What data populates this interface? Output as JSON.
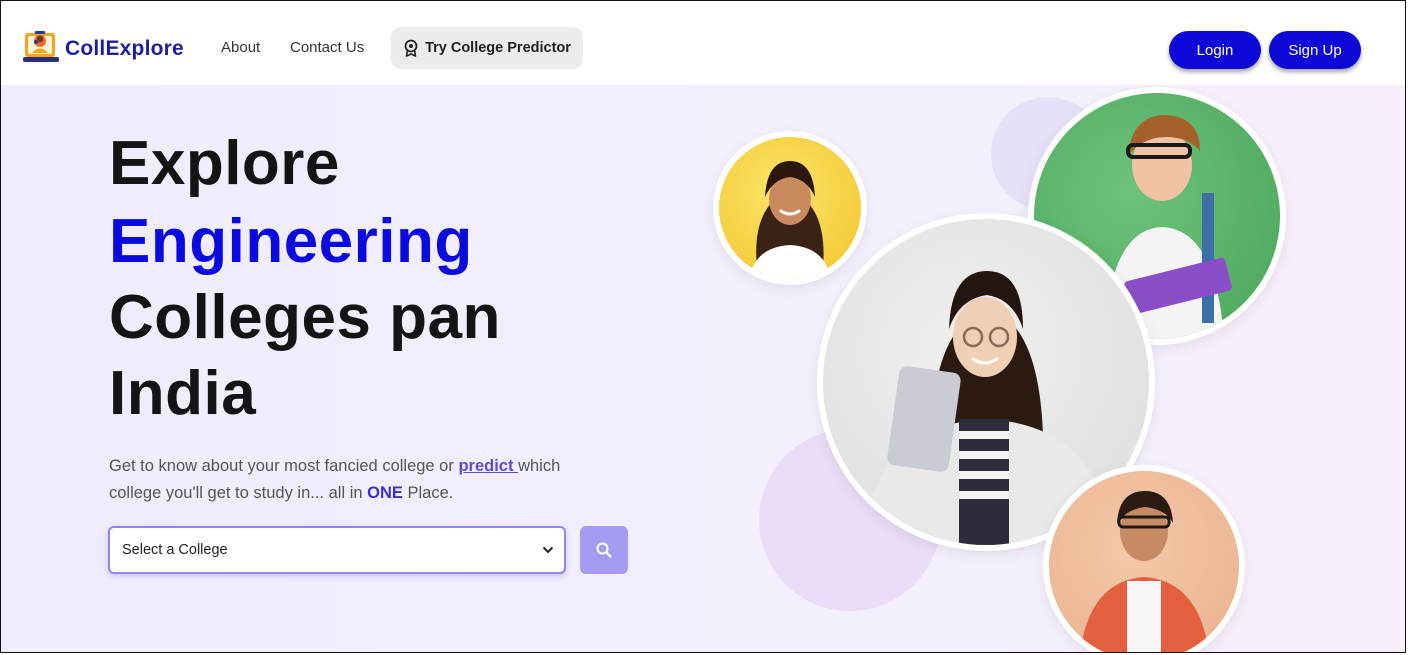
{
  "nav": {
    "brand": "CollExplore",
    "links": [
      "About",
      "Contact Us"
    ],
    "predictor_label": "Try College Predictor",
    "login_label": "Login",
    "signup_label": "Sign Up"
  },
  "hero": {
    "line1": "Explore",
    "line2": "Engineering",
    "line3": "Colleges pan",
    "line4": "India",
    "sub_part1": "Get to know about your most fancied college or ",
    "sub_link": "predict ",
    "sub_part2": "which college you'll get to study in... all in ",
    "sub_bold": "ONE",
    "sub_part3": " Place.",
    "select_placeholder": "Select a College"
  },
  "colors": {
    "brand": "#1e1f9e",
    "accent": "#0a09e0",
    "button": "#0d07d8",
    "search_button": "#a39cf0"
  },
  "icons": [
    "college-logo-icon",
    "award-icon",
    "chevron-down-icon",
    "search-icon"
  ]
}
